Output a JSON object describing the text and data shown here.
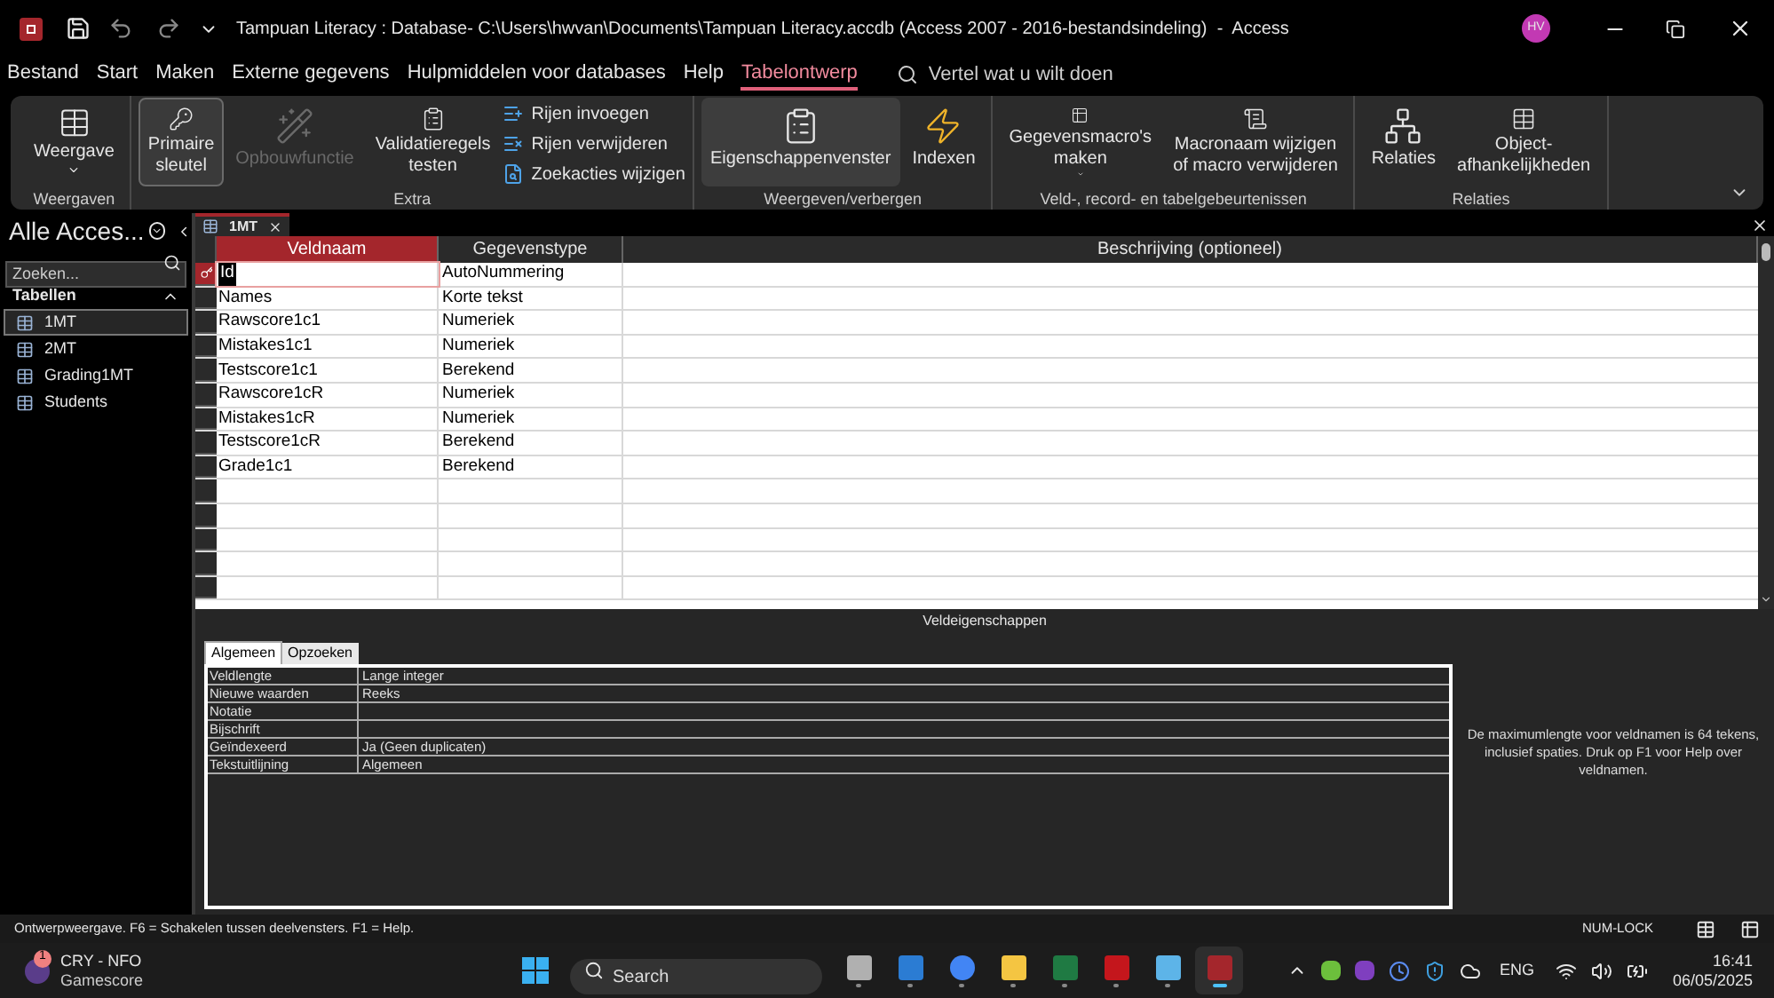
{
  "window": {
    "title": "Tampuan Literacy : Database- C:\\Users\\hwvan\\Documents\\Tampuan Literacy.accdb (Access 2007 - 2016-bestandsindeling)  -  Access",
    "user_initials": "HV"
  },
  "menu_tabs": [
    {
      "label": "Bestand",
      "selected": false
    },
    {
      "label": "Start",
      "selected": false
    },
    {
      "label": "Maken",
      "selected": false
    },
    {
      "label": "Externe gegevens",
      "selected": false
    },
    {
      "label": "Hulpmiddelen voor databases",
      "selected": false
    },
    {
      "label": "Help",
      "selected": false
    },
    {
      "label": "Tabelontwerp",
      "selected": true
    }
  ],
  "tell_me": {
    "placeholder": "Vertel wat u wilt doen"
  },
  "ribbon": {
    "groups": [
      {
        "label": "Weergaven",
        "commands": [
          {
            "kind": "large",
            "label_lines": [
              "Weergave"
            ],
            "dropdown": true,
            "on": false,
            "disabled": false
          }
        ]
      },
      {
        "label": "Extra",
        "commands": [
          {
            "kind": "large",
            "label_lines": [
              "Primaire",
              "sleutel"
            ],
            "dropdown": false,
            "on": true,
            "disabled": false
          },
          {
            "kind": "large",
            "label_lines": [
              "Opbouwfunctie"
            ],
            "dropdown": false,
            "on": false,
            "disabled": true
          },
          {
            "kind": "large",
            "label_lines": [
              "Validatieregels",
              "testen"
            ],
            "dropdown": false,
            "on": false,
            "disabled": false
          },
          {
            "kind": "stack",
            "items": [
              "Rijen invoegen",
              "Rijen verwijderen",
              "Zoekacties wijzigen"
            ]
          }
        ]
      },
      {
        "label": "Weergeven/verbergen",
        "commands": [
          {
            "kind": "large",
            "label_lines": [
              "Eigenschappenvenster"
            ],
            "dropdown": false,
            "on": true,
            "disabled": false
          },
          {
            "kind": "large",
            "label_lines": [
              "Indexen"
            ],
            "dropdown": false,
            "on": false,
            "disabled": false
          }
        ]
      },
      {
        "label": "Veld-, record- en tabelgebeurtenissen",
        "commands": [
          {
            "kind": "large",
            "label_lines": [
              "Gegevensmacro's",
              "maken"
            ],
            "dropdown": true,
            "on": false,
            "disabled": false
          },
          {
            "kind": "large",
            "label_lines": [
              "Macronaam wijzigen",
              "of macro verwijderen"
            ],
            "dropdown": false,
            "on": false,
            "disabled": false
          }
        ]
      },
      {
        "label": "Relaties",
        "commands": [
          {
            "kind": "large",
            "label_lines": [
              "Relaties"
            ],
            "dropdown": false,
            "on": false,
            "disabled": false
          },
          {
            "kind": "large",
            "label_lines": [
              "Object-",
              "afhankelijkheden"
            ],
            "dropdown": false,
            "on": false,
            "disabled": false
          }
        ]
      }
    ]
  },
  "nav_pane": {
    "title": "Alle Acces...",
    "search": {
      "placeholder": "Zoeken..."
    },
    "section": {
      "label": "Tabellen",
      "expanded": true
    },
    "items": [
      {
        "label": "1MT",
        "selected": true
      },
      {
        "label": "2MT",
        "selected": false
      },
      {
        "label": "Grading1MT",
        "selected": false
      },
      {
        "label": "Students",
        "selected": false
      }
    ]
  },
  "document_tab": {
    "label": "1MT"
  },
  "design_grid": {
    "columns": [
      "Veldnaam",
      "Gegevenstype",
      "Beschrijving (optioneel)"
    ],
    "rows": [
      {
        "name": "Id",
        "type": "AutoNummering",
        "primary_key": true,
        "selected": true
      },
      {
        "name": "Names",
        "type": "Korte tekst",
        "primary_key": false,
        "selected": false
      },
      {
        "name": "Rawscore1c1",
        "type": "Numeriek",
        "primary_key": false,
        "selected": false
      },
      {
        "name": "Mistakes1c1",
        "type": "Numeriek",
        "primary_key": false,
        "selected": false
      },
      {
        "name": "Testscore1c1",
        "type": "Berekend",
        "primary_key": false,
        "selected": false
      },
      {
        "name": "Rawscore1cR",
        "type": "Numeriek",
        "primary_key": false,
        "selected": false
      },
      {
        "name": "Mistakes1cR",
        "type": "Numeriek",
        "primary_key": false,
        "selected": false
      },
      {
        "name": "Testscore1cR",
        "type": "Berekend",
        "primary_key": false,
        "selected": false
      },
      {
        "name": "Grade1c1",
        "type": "Berekend",
        "primary_key": false,
        "selected": false
      }
    ]
  },
  "field_properties": {
    "title": "Veldeigenschappen",
    "tabs": [
      {
        "label": "Algemeen",
        "selected": true
      },
      {
        "label": "Opzoeken",
        "selected": false
      }
    ],
    "rows": [
      {
        "label": "Veldlengte",
        "value": "Lange integer"
      },
      {
        "label": "Nieuwe waarden",
        "value": "Reeks"
      },
      {
        "label": "Notatie"
      },
      {
        "label": "Bijschrift"
      },
      {
        "label": "Geïndexeerd",
        "value": "Ja (Geen duplicaten)"
      },
      {
        "label": "Tekstuitlijning",
        "value": "Algemeen"
      }
    ],
    "help": "De maximumlengte voor veldnamen is 64 tekens, inclusief spaties. Druk op F1 voor Help over veldnamen."
  },
  "status_bar": {
    "text": "Ontwerpweergave. F6 = Schakelen tussen deelvensters. F1 = Help.",
    "num_lock": "NUM-LOCK"
  },
  "taskbar": {
    "widget": {
      "badge": "1",
      "title": "CRY - NFO",
      "subtitle": "Gamescore"
    },
    "search": {
      "placeholder": "Search"
    },
    "apps": [
      {
        "active": false
      },
      {
        "active": false
      },
      {
        "active": false
      },
      {
        "active": false
      },
      {
        "active": false
      },
      {
        "active": false
      },
      {
        "active": false
      },
      {
        "active": true
      }
    ],
    "language": "ENG",
    "time": "16:41",
    "date": "06/05/2025"
  }
}
